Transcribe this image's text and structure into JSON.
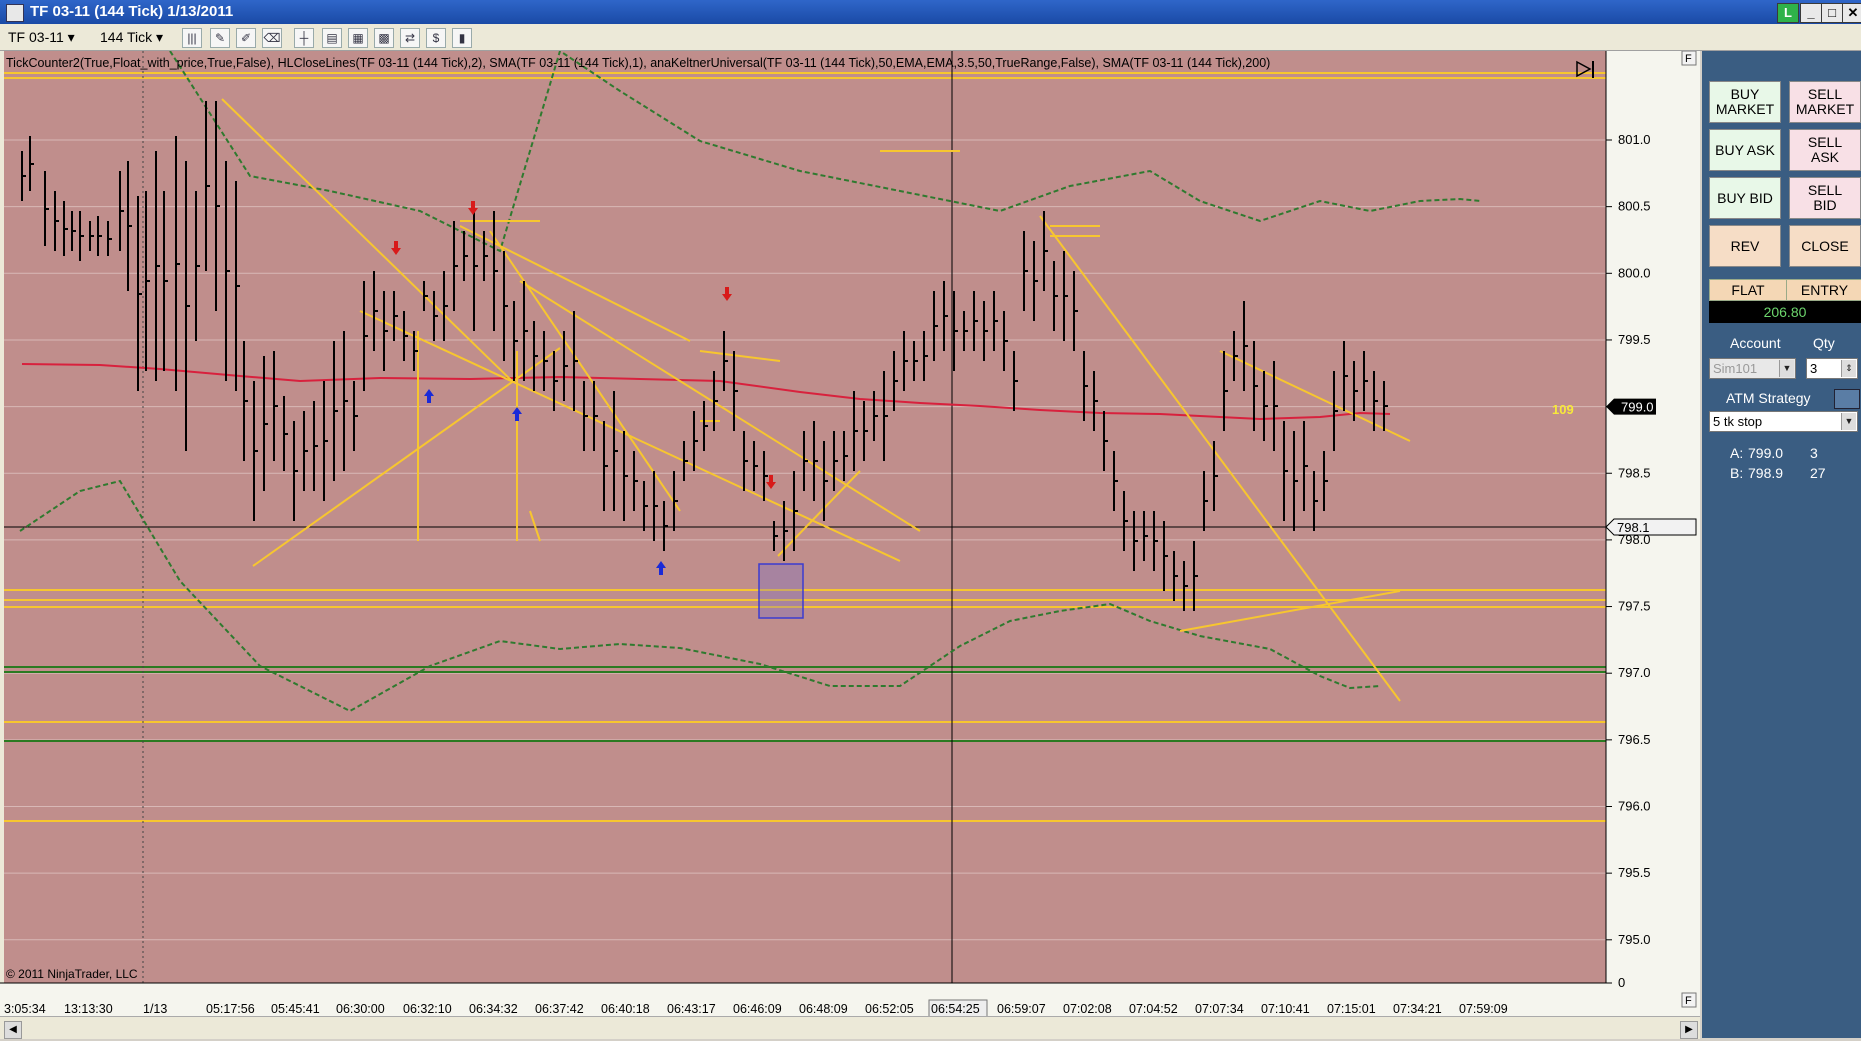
{
  "window": {
    "title": "TF 03-11 (144 Tick)  1/13/2011",
    "controls": [
      "L",
      "_",
      "□",
      "✕"
    ]
  },
  "toolbar": {
    "instrument": "TF 03-11",
    "interval": "144 Tick",
    "dropdown_glyph": "▾"
  },
  "chart": {
    "indicator_label": "TickCounter2(True,Float_with_price,True,False),  HLCloseLines(TF  03-11  (144  Tick),2),  SMA(TF  03-11  (144  Tick),1),  anaKeltnerUniversal(TF  03-11  (144  Tick),50,EMA,EMA,3.5,50,TrueRange,False),  SMA(TF  03-11  (144  Tick),200)",
    "copyright": "© 2011 NinjaTrader, LLC",
    "tick_counter": "109",
    "last_price": "799.0",
    "crosshair_price": "798.1",
    "crosshair_time": "06:54:25",
    "background_color": "#c08e8c",
    "price_axis_ticks": [
      "801.0",
      "800.5",
      "800.0",
      "799.5",
      "799.0",
      "798.5",
      "798.0",
      "797.5",
      "797.0",
      "796.5",
      "796.0",
      "795.5",
      "795.0",
      "0"
    ],
    "time_axis_ticks": [
      "3:05:34",
      "13:13:30",
      "1/13",
      "05:17:56",
      "05:45:41",
      "06:30:00",
      "06:32:10",
      "06:34:32",
      "06:37:42",
      "06:40:18",
      "06:43:17",
      "06:46:09",
      "06:48:09",
      "06:52:05",
      "06:54:25",
      "06:59:07",
      "07:02:08",
      "07:04:52",
      "07:07:34",
      "07:10:41",
      "07:15:01",
      "07:34:21",
      "07:59:09"
    ],
    "panel_button": "F"
  },
  "order_panel": {
    "buy_market": "BUY\nMARKET",
    "sell_market": "SELL\nMARKET",
    "buy_ask": "BUY ASK",
    "sell_ask": "SELL\nASK",
    "buy_bid": "BUY BID",
    "sell_bid": "SELL\nBID",
    "rev": "REV",
    "close": "CLOSE",
    "flat": "FLAT",
    "entry": "ENTRY",
    "pnl": "206.80",
    "account_label": "Account",
    "qty_label": "Qty",
    "account_value": "Sim101",
    "qty_value": "3",
    "atm_label": "ATM Strategy",
    "atm_value": "5 tk stop",
    "ask_label": "A:",
    "ask_price": "799.0",
    "ask_size": "3",
    "bid_label": "B:",
    "bid_price": "798.9",
    "bid_size": "27"
  },
  "colors": {
    "bars": "#000000",
    "trendlines": "#f7c62f",
    "sma200": "#d8213d",
    "keltner": "#2f7a2f",
    "up_arrow": "#1a2ad8",
    "down_arrow": "#d81a1a",
    "support_line": "#2b7a21"
  }
}
